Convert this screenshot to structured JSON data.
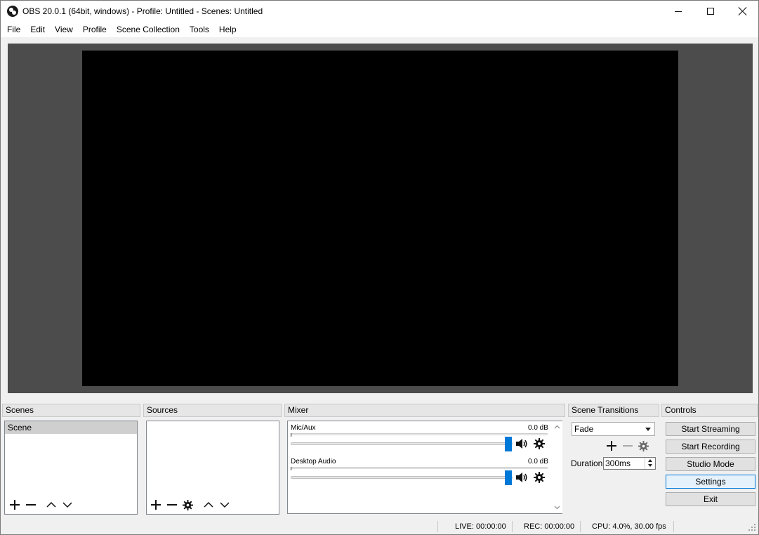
{
  "window": {
    "title": "OBS 20.0.1 (64bit, windows) - Profile: Untitled - Scenes: Untitled"
  },
  "menu": [
    "File",
    "Edit",
    "View",
    "Profile",
    "Scene Collection",
    "Tools",
    "Help"
  ],
  "docks": {
    "scenes": {
      "title": "Scenes",
      "items": [
        "Scene"
      ]
    },
    "sources": {
      "title": "Sources",
      "items": []
    },
    "mixer": {
      "title": "Mixer",
      "channels": [
        {
          "name": "Mic/Aux",
          "db": "0.0 dB",
          "volume_fraction": 1.0
        },
        {
          "name": "Desktop Audio",
          "db": "0.0 dB",
          "volume_fraction": 1.0
        }
      ]
    },
    "transitions": {
      "title": "Scene Transitions",
      "selected": "Fade",
      "duration_label": "Duration",
      "duration_value": "300ms"
    },
    "controls": {
      "title": "Controls",
      "buttons": [
        "Start Streaming",
        "Start Recording",
        "Studio Mode",
        "Settings",
        "Exit"
      ]
    }
  },
  "status": {
    "live": "LIVE: 00:00:00",
    "rec": "REC: 00:00:00",
    "cpu": "CPU: 4.0%, 30.00 fps"
  },
  "colors": {
    "accent": "#0078d7",
    "preview_bg": "#4c4c4c",
    "canvas": "#000000"
  }
}
